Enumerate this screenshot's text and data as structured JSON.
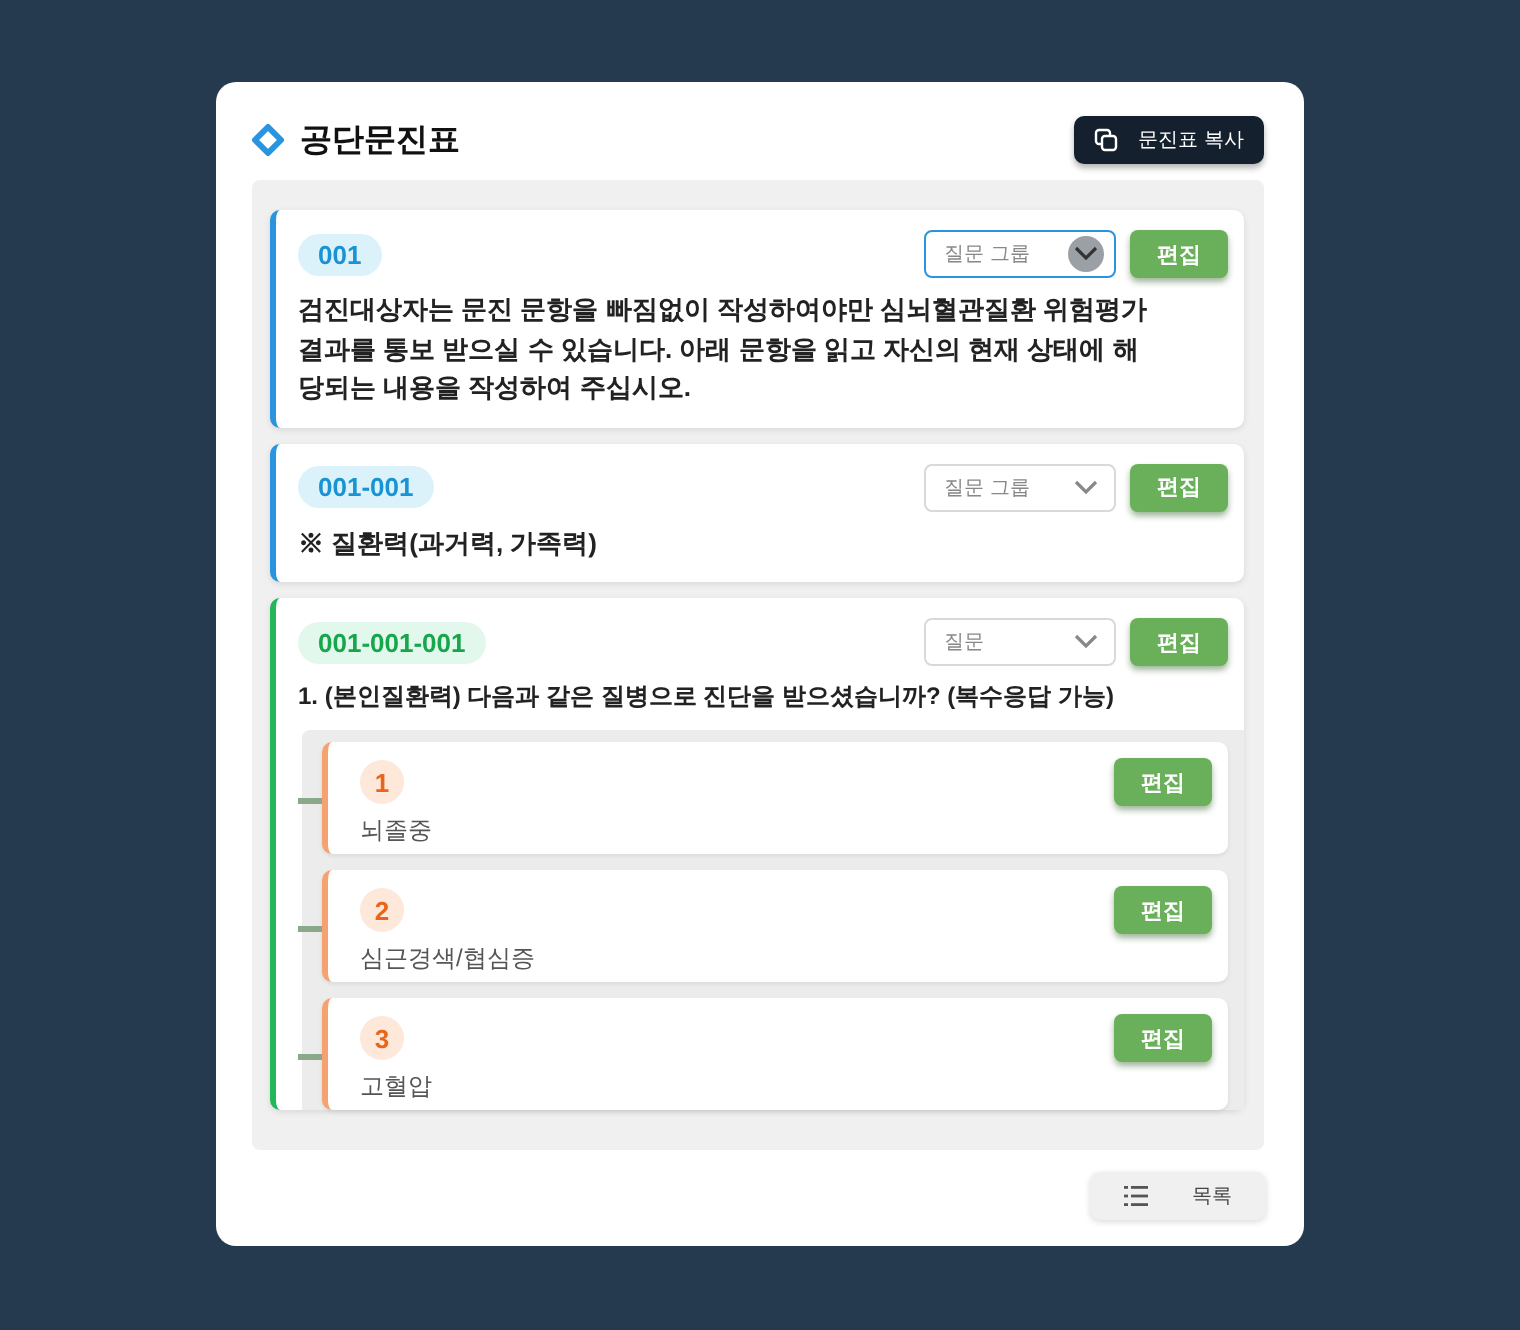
{
  "title": "공단문진표",
  "copy_button": "문진표 복사",
  "cards": [
    {
      "kind": "group",
      "code": "001",
      "select": {
        "placeholder": "질문 그룹",
        "focused": true
      },
      "edit_button": "편집",
      "text": "검진대상자는 문진 문항을 빠짐없이 작성하여야만 심뇌혈관질환 위험평가 결과를 통보 받으실 수 있습니다. 아래 문항을 읽고 자신의 현재 상태에 해당되는 내용을 작성하여 주십시오."
    },
    {
      "kind": "group",
      "code": "001-001",
      "select": {
        "placeholder": "질문 그룹",
        "focused": false
      },
      "edit_button": "편집",
      "text": "※ 질환력(과거력, 가족력)"
    },
    {
      "kind": "question",
      "code": "001-001-001",
      "select": {
        "placeholder": "질문",
        "focused": false
      },
      "edit_button": "편집",
      "text": "1. (본인질환력) 다음과 같은 질병으로 진단을 받으셨습니까? (복수응답 가능)",
      "children": [
        {
          "number": "1",
          "edit_button": "편집",
          "text": "뇌졸중"
        },
        {
          "number": "2",
          "edit_button": "편집",
          "text": "심근경색/협심증"
        },
        {
          "number": "3",
          "edit_button": "편집",
          "text": "고혈압"
        }
      ]
    }
  ],
  "list_button": "목록"
}
